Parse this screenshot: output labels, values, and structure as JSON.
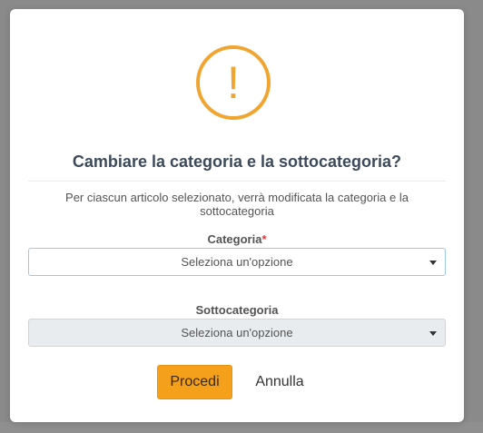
{
  "dialog": {
    "icon": "warning-exclamation-icon",
    "icon_glyph": "!",
    "accent_color": "#f0a531",
    "title": "Cambiare la categoria e la sottocategoria?",
    "description": "Per ciascun articolo selezionato, verrà modificata la categoria e la sottocategoria",
    "fields": {
      "categoria": {
        "label": "Categoria",
        "required_marker": "*",
        "value": "Seleziona un'opzione"
      },
      "sottocategoria": {
        "label": "Sottocategoria",
        "value": "Seleziona un'opzione"
      }
    },
    "buttons": {
      "confirm": "Procedi",
      "cancel": "Annulla"
    }
  }
}
